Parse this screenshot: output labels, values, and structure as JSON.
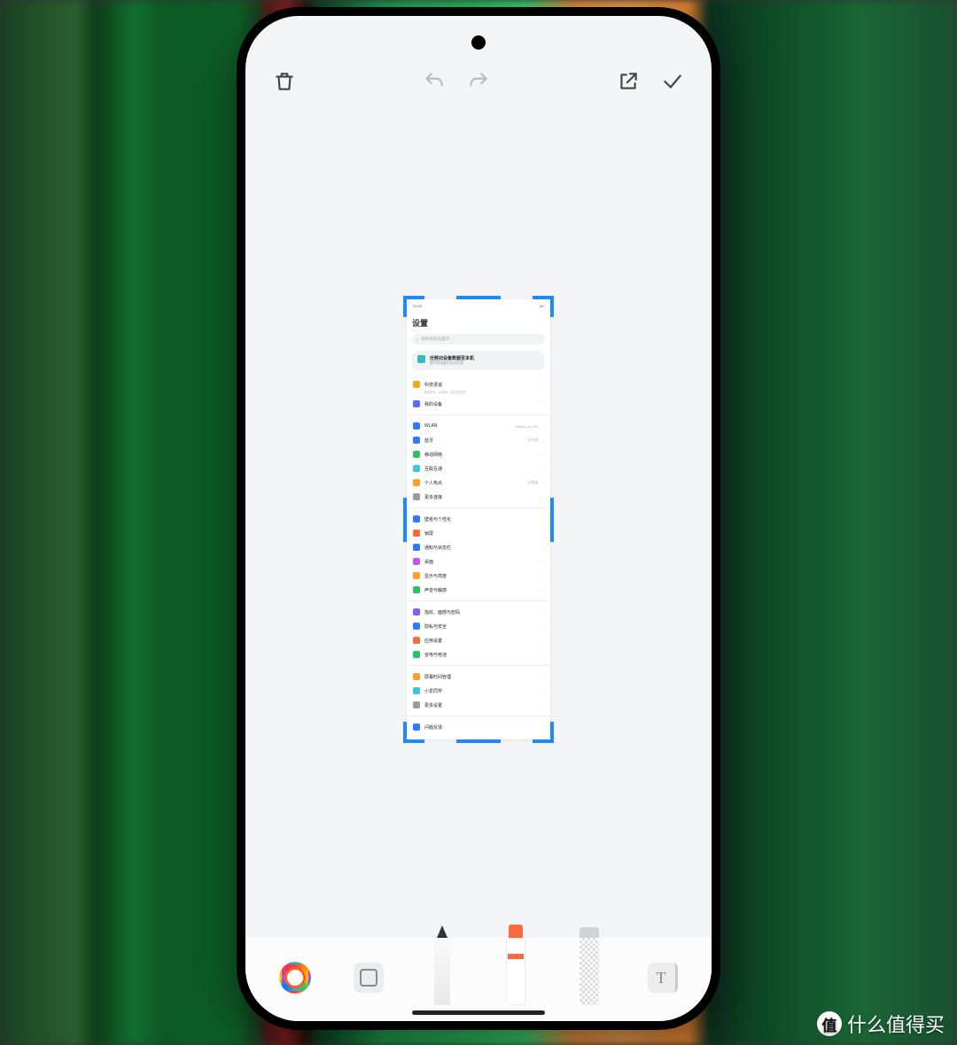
{
  "topbar": {
    "delete": "delete",
    "undo": "undo",
    "redo": "redo",
    "share": "share",
    "done": "done"
  },
  "screenshot": {
    "status_left": "22:00",
    "status_right": "5G",
    "title": "设置",
    "search_placeholder": "搜索系统设置项",
    "banner_title": "迁移旧设备数据至本机",
    "banner_sub": "换壳等设备均支持迁移",
    "groups": [
      [
        {
          "label": "科技漫谈",
          "sub": "登陆账号、云储存、会员权益等",
          "val": "",
          "color": "#f5a623"
        },
        {
          "label": "我的设备",
          "val": "",
          "color": "#5b6cff"
        }
      ],
      [
        {
          "label": "WLAN",
          "val": "Xiaomi_px_5G",
          "color": "#2f7bff"
        },
        {
          "label": "蓝牙",
          "val": "已开启",
          "color": "#2f7bff"
        },
        {
          "label": "移动网络",
          "val": "",
          "color": "#2fbf60"
        },
        {
          "label": "互联互通",
          "val": "",
          "color": "#40c8d0"
        },
        {
          "label": "个人热点",
          "val": "已关闭",
          "color": "#ff9f2e"
        },
        {
          "label": "更多连接",
          "val": "",
          "color": "#9a9c9f"
        }
      ],
      [
        {
          "label": "壁纸与个性化",
          "val": "",
          "color": "#2f7bff"
        },
        {
          "label": "锁屏",
          "val": "",
          "color": "#ff6a3c"
        },
        {
          "label": "通知与状态栏",
          "val": "",
          "color": "#2f7bff"
        },
        {
          "label": "桌面",
          "val": "",
          "color": "#c058e8"
        },
        {
          "label": "显示与亮度",
          "val": "",
          "color": "#ff9f2e"
        },
        {
          "label": "声音与触感",
          "val": "",
          "color": "#2fbf60"
        }
      ],
      [
        {
          "label": "指纹、面部与密码",
          "val": "",
          "color": "#8a5aff"
        },
        {
          "label": "隐私与安全",
          "val": "",
          "color": "#2f7bff"
        },
        {
          "label": "应用设置",
          "val": "",
          "color": "#ff6a3c"
        },
        {
          "label": "省电与电池",
          "val": "",
          "color": "#2fbf60"
        }
      ],
      [
        {
          "label": "屏幕时间管理",
          "val": "",
          "color": "#ff9f2e"
        },
        {
          "label": "小爱同学",
          "val": "",
          "color": "#40c8d0"
        },
        {
          "label": "更多设置",
          "val": "",
          "color": "#9a9c9f"
        }
      ],
      [
        {
          "label": "问题反馈",
          "val": "",
          "color": "#2f7bff"
        }
      ]
    ]
  },
  "toolbar": {
    "color": "color-picker",
    "shape": "shape",
    "pen": "fountain-pen",
    "marker": "marker",
    "eraser": "eraser",
    "text": "T"
  },
  "watermark": {
    "badge": "值",
    "text": "什么值得买"
  }
}
